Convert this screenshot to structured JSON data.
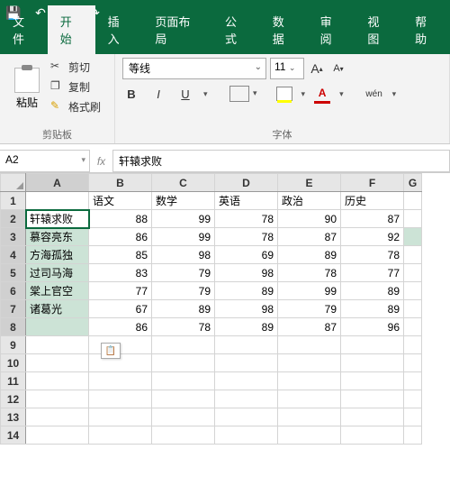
{
  "titlebar": {
    "save_icon": "💾",
    "undo_icon": "↶",
    "redo_icon": "↷"
  },
  "tabs": {
    "file": "文件",
    "home": "开始",
    "insert": "插入",
    "layout": "页面布局",
    "formula": "公式",
    "data": "数据",
    "review": "审阅",
    "view": "视图",
    "help": "帮助"
  },
  "ribbon": {
    "clipboard": {
      "paste": "粘贴",
      "cut": "剪切",
      "copy": "复制",
      "format_painter": "格式刷",
      "group_label": "剪贴板"
    },
    "font": {
      "name": "等线",
      "size": "11",
      "grow": "A",
      "shrink": "A",
      "bold": "B",
      "italic": "I",
      "underline": "U",
      "wen": "wén",
      "group_label": "字体"
    }
  },
  "formula_bar": {
    "name_box": "A2",
    "fx": "fx",
    "value": "轩辕求败"
  },
  "grid": {
    "col_headers": [
      "A",
      "B",
      "C",
      "D",
      "E",
      "F",
      "G"
    ],
    "row_headers": [
      "1",
      "2",
      "3",
      "4",
      "5",
      "6",
      "7",
      "8",
      "9",
      "10",
      "11",
      "12",
      "13",
      "14"
    ],
    "row1": {
      "B": "语文",
      "C": "数学",
      "D": "英语",
      "E": "政治",
      "F": "历史"
    },
    "rows": [
      {
        "A": "轩辕求败",
        "B": "88",
        "C": "99",
        "D": "78",
        "E": "90",
        "F": "87"
      },
      {
        "A": "慕容亮东",
        "B": "86",
        "C": "99",
        "D": "78",
        "E": "87",
        "F": "92"
      },
      {
        "A": "方海孤独",
        "B": "85",
        "C": "98",
        "D": "69",
        "E": "89",
        "F": "78"
      },
      {
        "A": "过司马海",
        "B": "83",
        "C": "79",
        "D": "98",
        "E": "78",
        "F": "77"
      },
      {
        "A": "棠上官空",
        "B": "77",
        "C": "79",
        "D": "89",
        "E": "99",
        "F": "89"
      },
      {
        "A": "诸葛光",
        "B": "67",
        "C": "89",
        "D": "98",
        "E": "79",
        "F": "89"
      },
      {
        "A": "",
        "B": "86",
        "C": "78",
        "D": "89",
        "E": "87",
        "F": "96"
      }
    ]
  }
}
